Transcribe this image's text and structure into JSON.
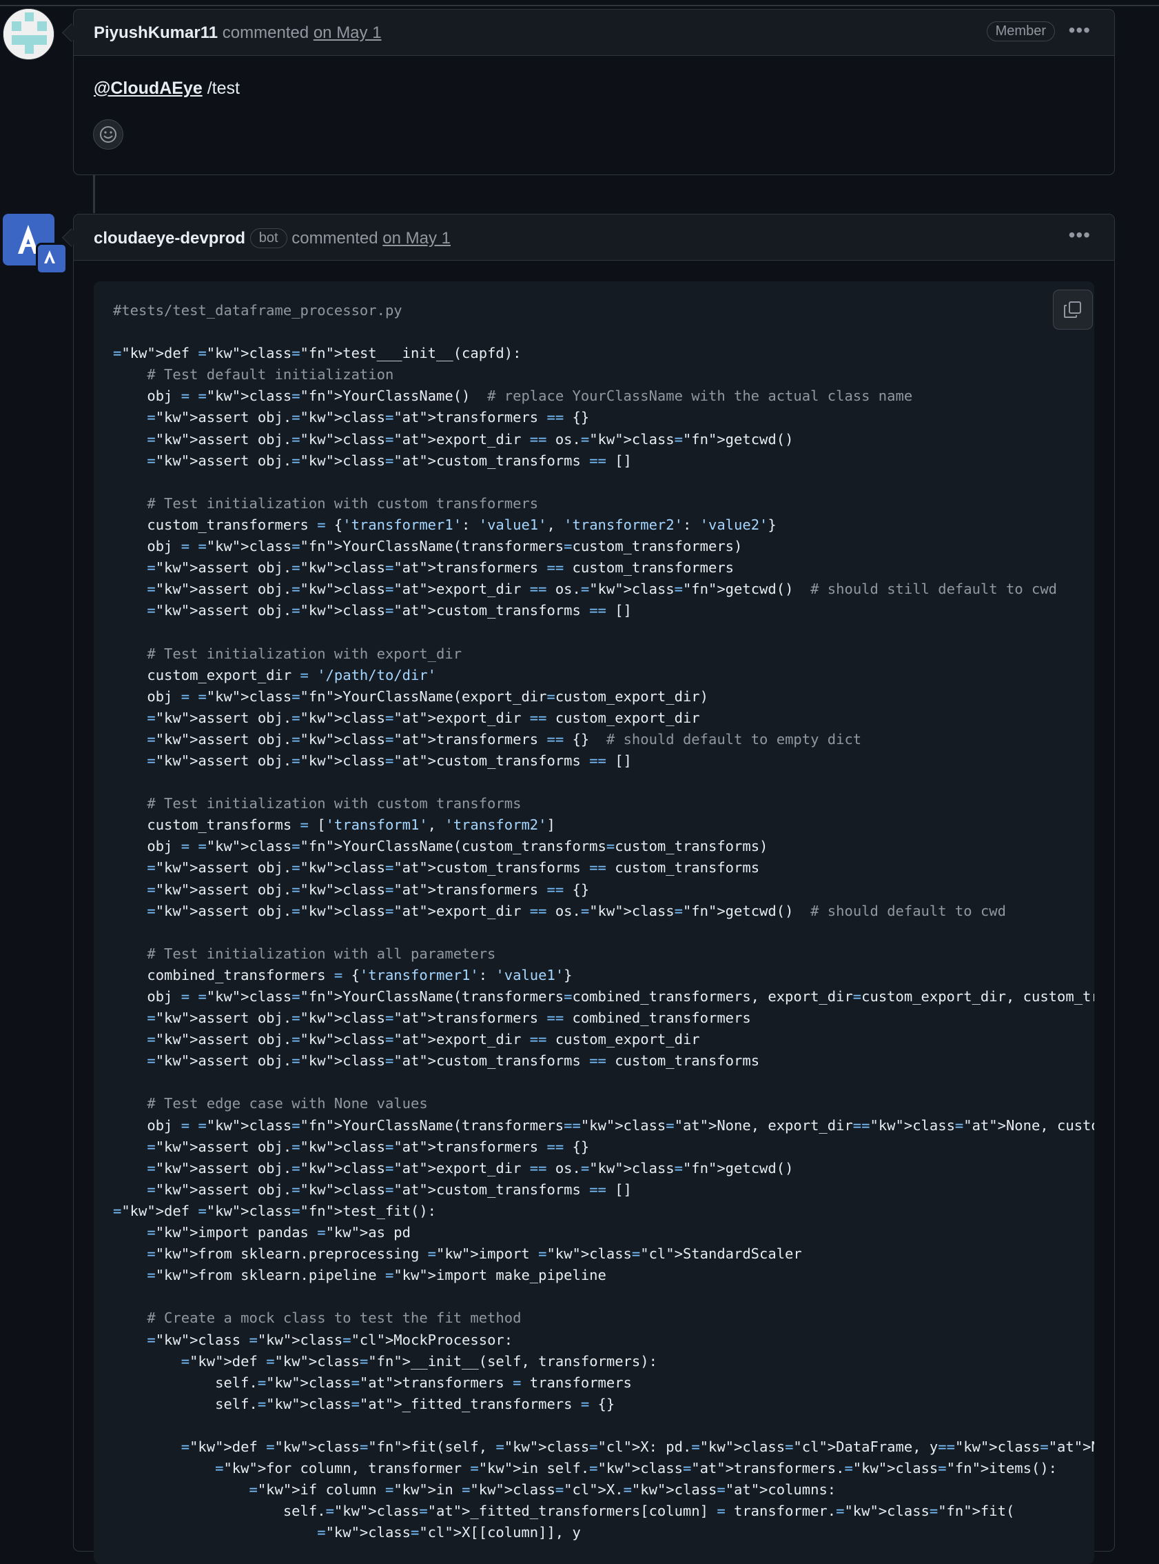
{
  "comments": [
    {
      "author": "PiyushKumar11",
      "action": "commented",
      "date": "on May 1",
      "role_badge": "Member",
      "more_icon": "kebab-horizontal-icon",
      "mention": "@CloudAEye",
      "body_text": "/test",
      "reaction_icon": "smiley-icon"
    },
    {
      "author": "cloudaeye-devprod",
      "bot_label": "bot",
      "action": "commented",
      "date": "on May 1",
      "more_icon": "kebab-horizontal-icon",
      "copy_icon": "copy-icon",
      "code_lines": [
        "#tests/test_dataframe_processor.py",
        "",
        "def test___init__(capfd):",
        "    # Test default initialization",
        "    obj = YourClassName()  # replace YourClassName with the actual class name",
        "    assert obj.transformers == {}",
        "    assert obj.export_dir == os.getcwd()",
        "    assert obj.custom_transforms == []",
        "",
        "    # Test initialization with custom transformers",
        "    custom_transformers = {'transformer1': 'value1', 'transformer2': 'value2'}",
        "    obj = YourClassName(transformers=custom_transformers)",
        "    assert obj.transformers == custom_transformers",
        "    assert obj.export_dir == os.getcwd()  # should still default to cwd",
        "    assert obj.custom_transforms == []",
        "",
        "    # Test initialization with export_dir",
        "    custom_export_dir = '/path/to/dir'",
        "    obj = YourClassName(export_dir=custom_export_dir)",
        "    assert obj.export_dir == custom_export_dir",
        "    assert obj.transformers == {}  # should default to empty dict",
        "    assert obj.custom_transforms == []",
        "",
        "    # Test initialization with custom transforms",
        "    custom_transforms = ['transform1', 'transform2']",
        "    obj = YourClassName(custom_transforms=custom_transforms)",
        "    assert obj.custom_transforms == custom_transforms",
        "    assert obj.transformers == {}",
        "    assert obj.export_dir == os.getcwd()  # should default to cwd",
        "",
        "    # Test initialization with all parameters",
        "    combined_transformers = {'transformer1': 'value1'}",
        "    obj = YourClassName(transformers=combined_transformers, export_dir=custom_export_dir, custom_transforms=custom_transforms)",
        "    assert obj.transformers == combined_transformers",
        "    assert obj.export_dir == custom_export_dir",
        "    assert obj.custom_transforms == custom_transforms",
        "",
        "    # Test edge case with None values",
        "    obj = YourClassName(transformers=None, export_dir=None, custom_transforms=None)",
        "    assert obj.transformers == {}",
        "    assert obj.export_dir == os.getcwd()",
        "    assert obj.custom_transforms == []",
        "def test_fit():",
        "    import pandas as pd",
        "    from sklearn.preprocessing import StandardScaler",
        "    from sklearn.pipeline import make_pipeline",
        "",
        "    # Create a mock class to test the fit method",
        "    class MockProcessor:",
        "        def __init__(self, transformers):",
        "            self.transformers = transformers",
        "            self._fitted_transformers = {}",
        "",
        "        def fit(self, X: pd.DataFrame, y=None):",
        "            for column, transformer in self.transformers.items():",
        "                if column in X.columns:",
        "                    self._fitted_transformers[column] = transformer.fit(",
        "                        X[[column]], y"
      ]
    }
  ]
}
